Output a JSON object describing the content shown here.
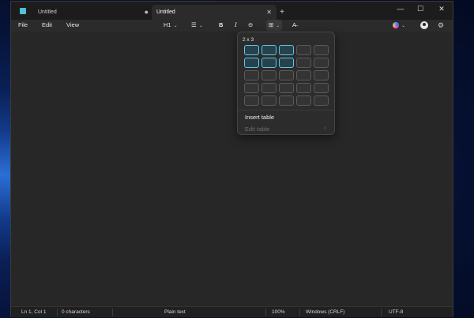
{
  "window": {
    "tabs": [
      {
        "label": "Untitled",
        "unsaved_marker": "●",
        "active": false
      },
      {
        "label": "Untitled",
        "close_glyph": "✕",
        "active": true
      }
    ],
    "new_tab_glyph": "+",
    "controls": {
      "minimize": "—",
      "maximize": "☐",
      "close": "✕"
    }
  },
  "menu": {
    "file": "File",
    "edit": "Edit",
    "view": "View"
  },
  "toolbar": {
    "heading": "H1",
    "list_glyph": "☰",
    "bold": "B",
    "italic": "I",
    "link_glyph": "⊖",
    "table_glyph": "⊞",
    "clear_format_glyph": "A̶",
    "chevron": "⌄",
    "settings_glyph": "⚙"
  },
  "table_flyout": {
    "size_label": "2 x 3",
    "rows": 5,
    "cols": 5,
    "selected_rows": 2,
    "selected_cols": 3,
    "insert_label": "Insert table",
    "edit_label": "Edit table",
    "edit_chevron": "›"
  },
  "status": {
    "position": "Ln 1, Col 1",
    "characters": "0 characters",
    "format": "Plain text",
    "zoom": "100%",
    "line_ending": "Windows (CRLF)",
    "encoding": "UTF-8"
  },
  "colors": {
    "accent": "#5fc8e6",
    "background": "#272727"
  }
}
